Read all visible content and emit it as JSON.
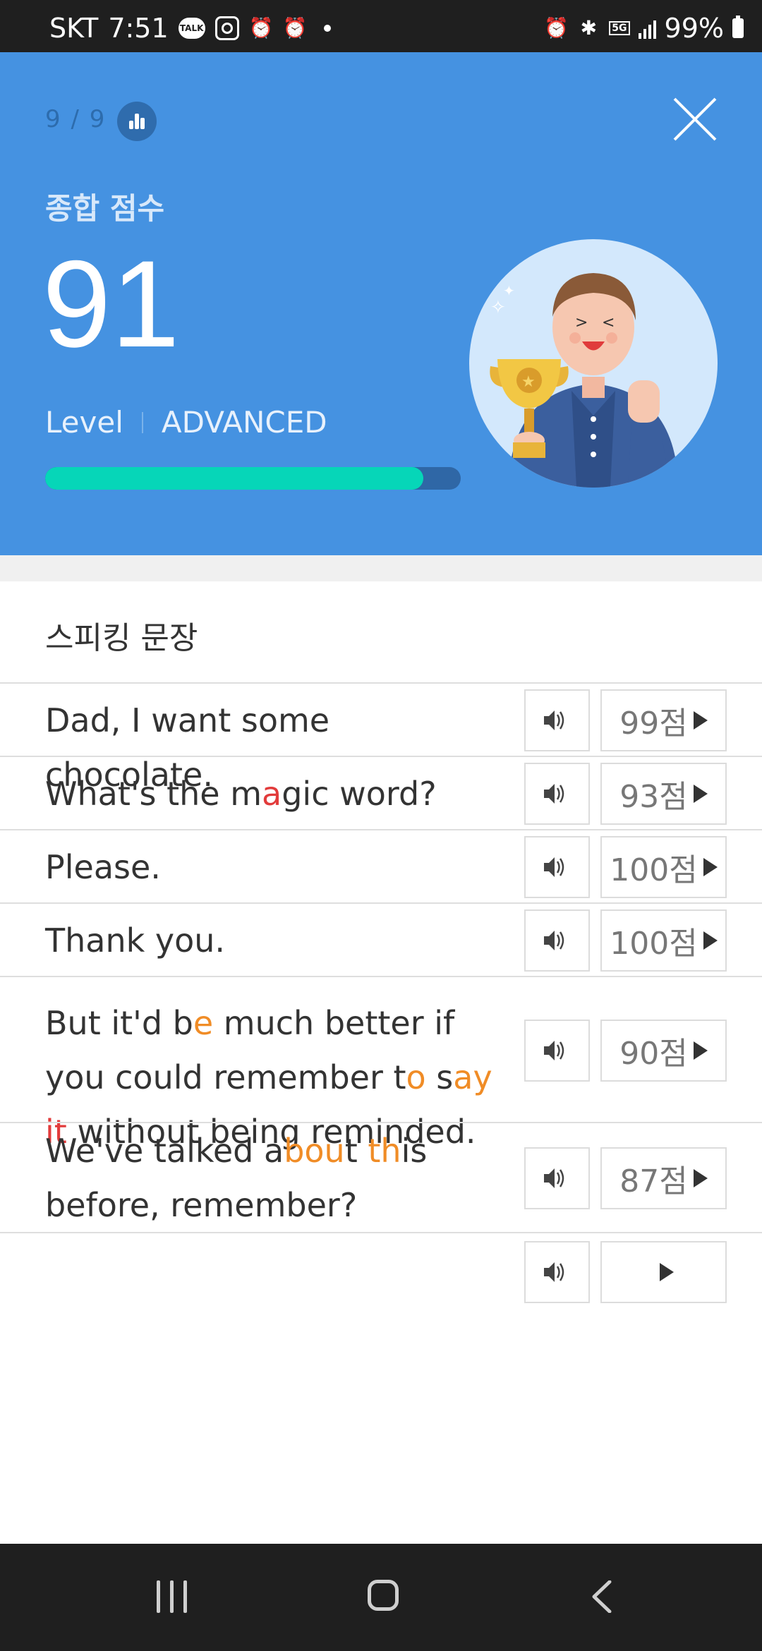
{
  "status_bar": {
    "carrier": "SKT",
    "time": "7:51",
    "talk_badge": "TALK",
    "net": "5G",
    "battery": "99%",
    "left_icons": [
      "kakaotalk-icon",
      "instagram-icon",
      "alarm-icon",
      "alarm-icon",
      "dot-icon"
    ],
    "right_icons": [
      "alarm-icon",
      "bluetooth-icon",
      "5g-icon",
      "signal-icon",
      "battery-icon"
    ]
  },
  "header": {
    "progress": "9 / 9",
    "score_label": "종합 점수",
    "score": "91",
    "level_label": "Level",
    "level_value": "ADVANCED",
    "progress_fraction": 0.91,
    "colors": {
      "bg": "#4592e1",
      "bar_fill": "#06d6b8",
      "bar_track": "#2f67a6"
    }
  },
  "section": {
    "title": "스피킹 문장"
  },
  "sentences": [
    {
      "segments": [
        {
          "t": "Dad, I want some chocolate."
        }
      ],
      "score": "99점"
    },
    {
      "segments": [
        {
          "t": "What's the m"
        },
        {
          "t": "a",
          "c": "r"
        },
        {
          "t": "gic word?"
        }
      ],
      "score": "93점"
    },
    {
      "segments": [
        {
          "t": "Please."
        }
      ],
      "score": "100점"
    },
    {
      "segments": [
        {
          "t": "Thank you."
        }
      ],
      "score": "100점"
    },
    {
      "segments": [
        {
          "t": "But it'd b"
        },
        {
          "t": "e",
          "c": "o"
        },
        {
          "t": " much better if you could remember t"
        },
        {
          "t": "o",
          "c": "o"
        },
        {
          "t": " s"
        },
        {
          "t": "ay",
          "c": "o"
        },
        {
          "t": " "
        },
        {
          "t": "it",
          "c": "r"
        },
        {
          "t": " without being reminded."
        }
      ],
      "score": "90점"
    },
    {
      "segments": [
        {
          "t": "We've talked a"
        },
        {
          "t": "bou",
          "c": "o"
        },
        {
          "t": "t "
        },
        {
          "t": "th",
          "c": "o"
        },
        {
          "t": "is before, remember?"
        }
      ],
      "score": "87점"
    },
    {
      "segments": [
        {
          "t": ""
        }
      ],
      "score": ""
    }
  ],
  "highlight_colors": {
    "o": "#f08c26",
    "r": "#e23b3b"
  }
}
